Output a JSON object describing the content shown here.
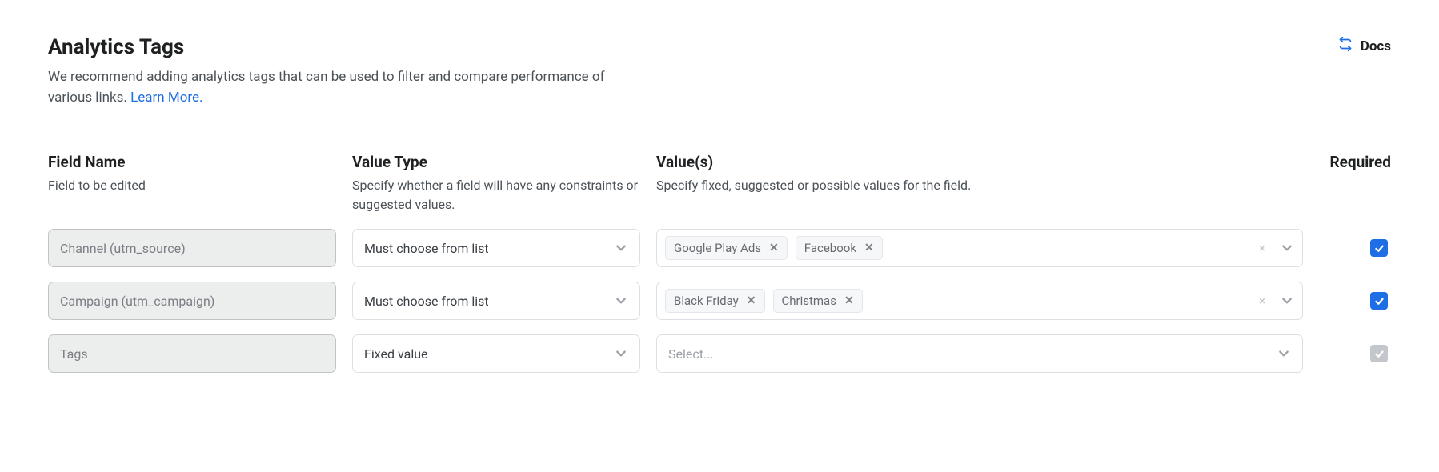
{
  "header": {
    "title": "Analytics Tags",
    "subtitle_a": "We recommend adding analytics tags that can be used to filter and compare performance of various links. ",
    "learn_more": "Learn More.",
    "docs": "Docs"
  },
  "columns": {
    "field_name": {
      "title": "Field Name",
      "desc": "Field to be edited"
    },
    "value_type": {
      "title": "Value Type",
      "desc": "Specify whether a field will have any constraints or suggested values."
    },
    "values": {
      "title": "Value(s)",
      "desc": "Specify fixed, suggested or possible values for the field."
    },
    "required": {
      "title": "Required"
    }
  },
  "rows": [
    {
      "field": "Channel (utm_source)",
      "value_type": "Must choose from list",
      "tags": [
        "Google Play Ads",
        "Facebook"
      ],
      "values_placeholder": "",
      "required": true,
      "required_disabled": false
    },
    {
      "field": "Campaign (utm_campaign)",
      "value_type": "Must choose from list",
      "tags": [
        "Black Friday",
        "Christmas"
      ],
      "values_placeholder": "",
      "required": true,
      "required_disabled": false
    },
    {
      "field": "Tags",
      "value_type": "Fixed value",
      "tags": [],
      "values_placeholder": "Select...",
      "required": true,
      "required_disabled": true
    }
  ]
}
